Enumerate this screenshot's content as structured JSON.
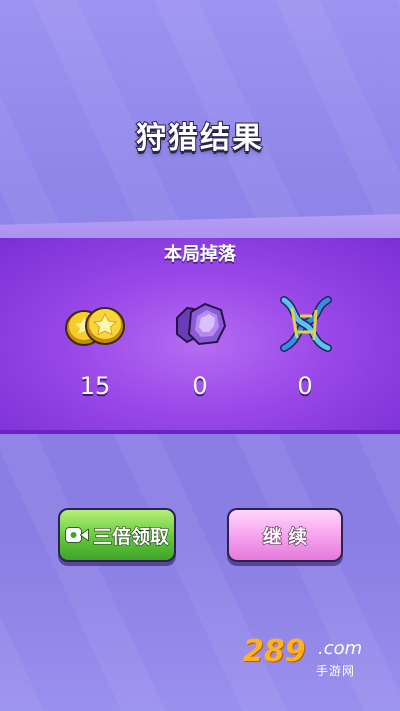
{
  "title": "狩猎结果",
  "drops_header": "本局掉落",
  "drops": [
    {
      "icon": "gold-coin-icon",
      "count": "15"
    },
    {
      "icon": "purple-gem-icon",
      "count": "0"
    },
    {
      "icon": "dna-icon",
      "count": "0"
    }
  ],
  "buttons": {
    "triple_claim_label": "三倍领取",
    "continue_label": "继 续"
  },
  "watermark": {
    "logo": "289",
    "domain": ".com",
    "subtitle": "手游网"
  },
  "colors": {
    "background": "#8f86ea",
    "band": "#9a48e8",
    "green_button": "#63c83a",
    "pink_button": "#f6a0ee",
    "coin": "#f2c21a",
    "gem": "#8a5ad8",
    "dna": "#3b8be6"
  }
}
